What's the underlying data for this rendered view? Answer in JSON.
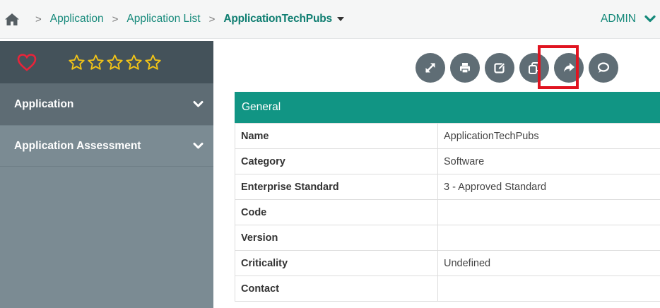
{
  "breadcrumb": {
    "home_icon": "home-icon",
    "items": [
      "Application",
      "Application List"
    ],
    "current": "ApplicationTechPubs"
  },
  "user": {
    "name": "ADMIN"
  },
  "sidebar": {
    "favorite_icon": "heart-icon",
    "rating_stars": 5,
    "items": [
      {
        "label": "Application"
      },
      {
        "label": "Application Assessment"
      }
    ]
  },
  "toolbar": {
    "buttons": [
      {
        "icon": "expand-icon"
      },
      {
        "icon": "print-icon"
      },
      {
        "icon": "edit-icon"
      },
      {
        "icon": "copy-icon",
        "highlighted": true
      },
      {
        "icon": "share-icon"
      },
      {
        "icon": "comment-icon"
      }
    ]
  },
  "general": {
    "title": "General",
    "rows": [
      {
        "label": "Name",
        "value": "ApplicationTechPubs"
      },
      {
        "label": "Category",
        "value": "Software"
      },
      {
        "label": "Enterprise Standard",
        "value": "3 - Approved Standard"
      },
      {
        "label": "Code",
        "value": ""
      },
      {
        "label": "Version",
        "value": ""
      },
      {
        "label": "Criticality",
        "value": "Undefined"
      },
      {
        "label": "Contact",
        "value": ""
      }
    ]
  },
  "colors": {
    "accent": "#119584",
    "link": "#15897a",
    "sidebar": "#7b8b93",
    "sidebar_dark": "#44525a",
    "highlight": "#e01420",
    "heart": "#e8243a",
    "star": "#f2c417"
  }
}
